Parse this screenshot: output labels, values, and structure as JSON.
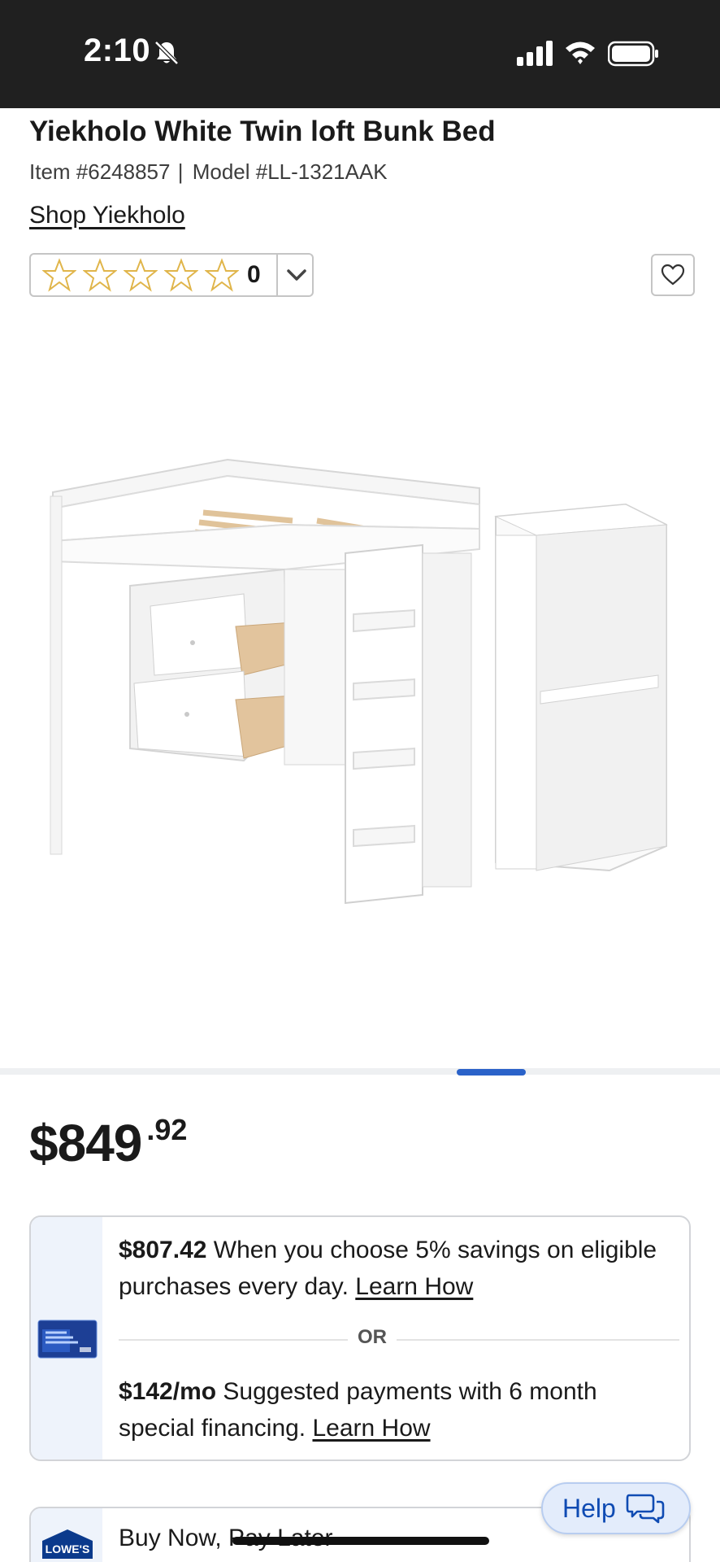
{
  "status_bar": {
    "time": "2:10",
    "icons": [
      "bell-slash-icon",
      "signal-icon",
      "wifi-icon",
      "battery-icon"
    ]
  },
  "product": {
    "title": "Yiekholo White Twin loft Bunk Bed",
    "item_number": "Item #6248857",
    "separator": "|",
    "model_number": "Model #LL-1321AAK",
    "shop_link": "Shop Yiekholo",
    "rating": {
      "stars_filled": 0,
      "stars_total": 5,
      "count": "0"
    },
    "image_alt": "white twin loft bunk bed with drawers, ladder shelves and rolling bookcase",
    "carousel_position": 1
  },
  "price": {
    "dollars": "$849",
    "cents": ".92"
  },
  "savings_card": {
    "option1_amount": "$807.42",
    "option1_text": " When you choose 5% savings on eligible purchases every day. ",
    "option1_link": "Learn How",
    "or_text": "OR",
    "option2_amount": "$142/mo",
    "option2_text": " Suggested payments with 6 month special financing. ",
    "option2_link": "Learn How"
  },
  "bnpl": {
    "text": "Buy Now, Pay Later"
  },
  "help_button": {
    "label": "Help"
  },
  "colors": {
    "status_bar_bg": "#202020",
    "star": "#e0b54a",
    "accent_blue": "#2a62c9",
    "help_text": "#0f4bb3"
  }
}
